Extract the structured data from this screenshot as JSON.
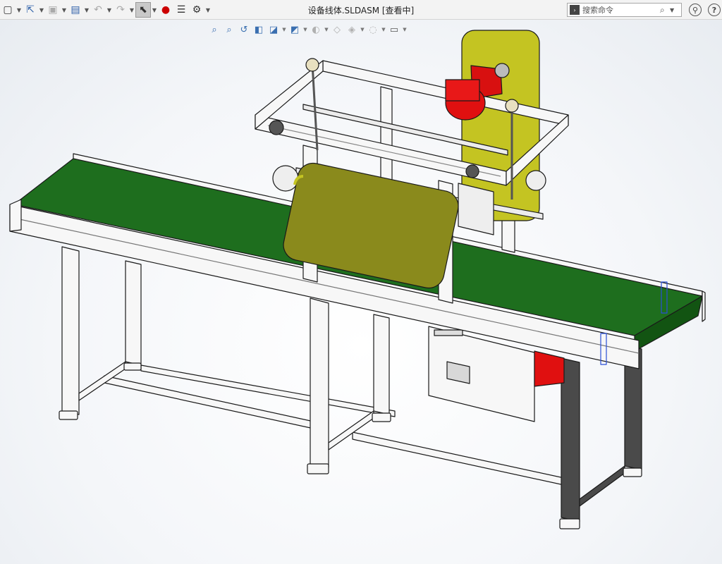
{
  "window": {
    "title": "设备线体.SLDASM [查看中]"
  },
  "toolbar": {
    "left_items": [
      {
        "name": "new-icon",
        "glyph": "▢"
      },
      {
        "name": "open-icon",
        "glyph": "📂"
      },
      {
        "name": "save-icon",
        "glyph": "💾"
      },
      {
        "name": "print-icon",
        "glyph": "🖶"
      },
      {
        "name": "undo-icon",
        "glyph": "↶"
      },
      {
        "name": "redo-icon",
        "glyph": "↷"
      },
      {
        "name": "select-icon",
        "glyph": "⬉"
      },
      {
        "name": "rebuild-icon",
        "glyph": "🚦"
      },
      {
        "name": "file-properties-icon",
        "glyph": "▤"
      },
      {
        "name": "options-icon",
        "glyph": "⚙"
      }
    ]
  },
  "search": {
    "placeholder": "搜索命令"
  },
  "heads_up_toolbar": [
    {
      "name": "zoom-to-fit-icon",
      "glyph": "⌕"
    },
    {
      "name": "zoom-to-area-icon",
      "glyph": "⌕"
    },
    {
      "name": "previous-view-icon",
      "glyph": "↺"
    },
    {
      "name": "section-view-icon",
      "glyph": "◧"
    },
    {
      "name": "dynamic-annotation-icon",
      "glyph": "◪"
    },
    {
      "name": "view-orientation-icon",
      "glyph": "◩"
    },
    {
      "name": "display-style-icon",
      "glyph": "◐"
    },
    {
      "name": "hide-show-items-icon",
      "glyph": "◇"
    },
    {
      "name": "edit-appearance-icon",
      "glyph": "◈"
    },
    {
      "name": "apply-scene-icon",
      "glyph": "◌"
    },
    {
      "name": "view-settings-icon",
      "glyph": "▭"
    }
  ],
  "colors": {
    "belt": "#1e6e1e",
    "belt_dark": "#125412",
    "panel_yellow": "#c4c422",
    "panel_olive": "#8a8a1c",
    "motor_red": "#e01010",
    "frame": "#f7f7f7",
    "leg_dark": "#4a4a4a",
    "outline": "#1a1a1a"
  }
}
